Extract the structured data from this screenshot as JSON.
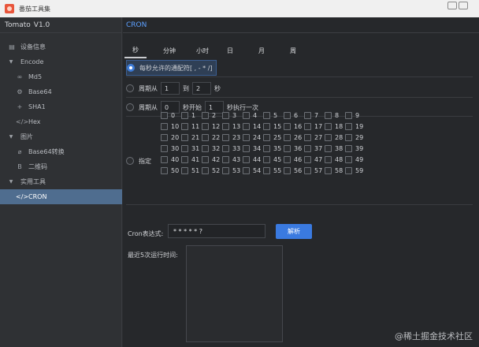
{
  "window": {
    "title": "番茄工具集"
  },
  "sidebar": {
    "app_name": "Tomato",
    "version": "V1.0",
    "items": [
      {
        "label": "设备信息",
        "level": 0,
        "icon": "device-icon"
      },
      {
        "label": "Encode",
        "level": 0,
        "icon": "caret-down-icon"
      },
      {
        "label": "Md5",
        "level": 1,
        "icon": "link-icon"
      },
      {
        "label": "Base64",
        "level": 1,
        "icon": "gear-icon"
      },
      {
        "label": "SHA1",
        "level": 1,
        "icon": "plus-icon"
      },
      {
        "label": "Hex",
        "level": 1,
        "icon": "code-icon"
      },
      {
        "label": "图片",
        "level": 0,
        "icon": "caret-down-icon"
      },
      {
        "label": "Base64转换",
        "level": 1,
        "icon": "attachment-icon"
      },
      {
        "label": "二维码",
        "level": 1,
        "icon": "bold-b-icon"
      },
      {
        "label": "实用工具",
        "level": 0,
        "icon": "caret-down-icon"
      },
      {
        "label": "CRON",
        "level": 1,
        "icon": "code-icon",
        "active": true
      }
    ]
  },
  "main": {
    "title": "CRON",
    "tabs": [
      "秒",
      "分钟",
      "小时",
      "日",
      "月",
      "周"
    ],
    "selected_tab": "秒",
    "options": {
      "every": "每秒允许的通配符[ , - * /]",
      "period_from": "周期从",
      "period_from_start": "1",
      "period_to": "到",
      "period_to_end": "2",
      "period_unit": "秒",
      "cycle_from": "周期从",
      "cycle_start": "0",
      "cycle_mid": "秒开始",
      "cycle_step": "1",
      "cycle_end": "秒执行一次",
      "assign": "指定"
    },
    "seconds": [
      "0",
      "1",
      "2",
      "3",
      "4",
      "5",
      "6",
      "7",
      "8",
      "9",
      "10",
      "11",
      "12",
      "13",
      "14",
      "15",
      "16",
      "17",
      "18",
      "19",
      "20",
      "21",
      "22",
      "23",
      "24",
      "25",
      "26",
      "27",
      "28",
      "29",
      "30",
      "31",
      "32",
      "33",
      "34",
      "35",
      "36",
      "37",
      "38",
      "39",
      "40",
      "41",
      "42",
      "43",
      "44",
      "45",
      "46",
      "47",
      "48",
      "49",
      "50",
      "51",
      "52",
      "53",
      "54",
      "55",
      "56",
      "57",
      "58",
      "59"
    ],
    "expr_label": "Cron表达式:",
    "expr_value": "* * * * * ?",
    "parse_label": "解析",
    "recent_label": "最近5次运行时间:"
  },
  "watermark": "@稀土掘金技术社区",
  "colors": {
    "accent": "#3a7ae0",
    "active_item": "#4f6d8f",
    "title_text": "#5ca0ff"
  }
}
